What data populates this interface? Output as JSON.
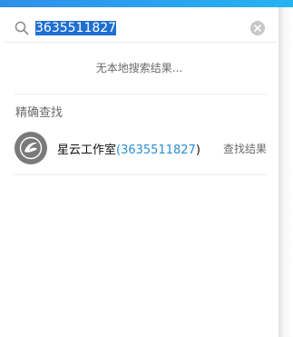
{
  "search": {
    "value": "3635511827"
  },
  "status": {
    "no_local_results": "无本地搜索结果..."
  },
  "section": {
    "title": "精确查找"
  },
  "result": {
    "name": "星云工作室",
    "open_paren": "(",
    "id": "3635511827",
    "close_paren": ")",
    "action_label": "查找结果"
  },
  "colors": {
    "accent": "#2a8ed6",
    "selection": "#1f6fd1",
    "top_strip": "#2f8fe8"
  },
  "icons": {
    "search": "search-icon",
    "clear": "clear-icon",
    "avatar": "avatar-logo-icon"
  }
}
